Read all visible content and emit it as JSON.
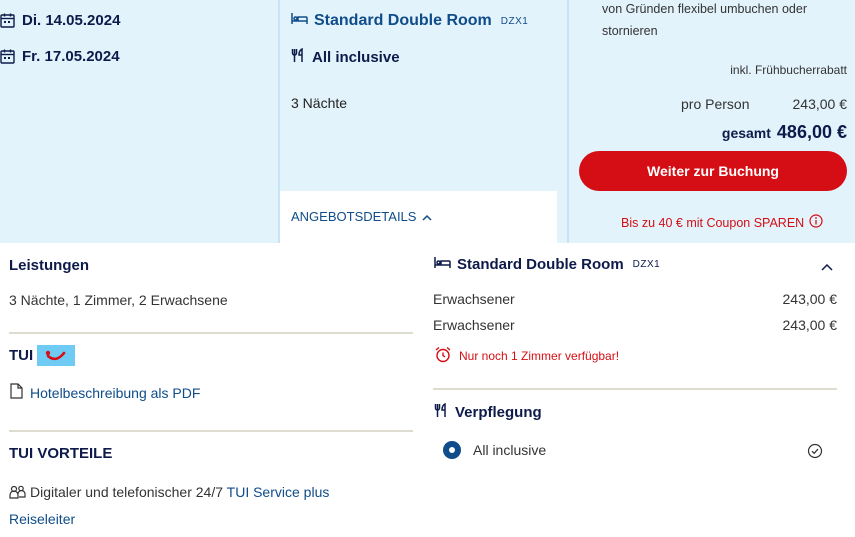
{
  "dates": {
    "arrival": "Di. 14.05.2024",
    "departure": "Fr. 17.05.2024"
  },
  "offer": {
    "room_name": "Standard Double Room",
    "room_code": "DZX1",
    "board": "All inclusive",
    "nights": "3 Nächte",
    "details_tab": "ANGEBOTSDETAILS"
  },
  "pricing": {
    "flex_text": "von Gründen flexibel umbuchen oder stornieren",
    "early_booking": "inkl. Frühbucherrabatt",
    "per_person_label": "pro Person",
    "per_person_value": "243,00 €",
    "total_label": "gesamt",
    "total_value": "486,00 €",
    "book_button": "Weiter zur Buchung",
    "coupon_text": "Bis zu 40 € mit Coupon SPAREN"
  },
  "services": {
    "heading": "Leistungen",
    "summary": "3 Nächte, 1 Zimmer, 2 Erwachsene",
    "brand": "TUI",
    "pdf_link": "Hotelbeschreibung als PDF",
    "benefits_heading": "TUI VORTEILE",
    "benefit_text": "Digitaler und telefonischer 24/7",
    "benefit_link": "TUI Service plus Reiseleiter"
  },
  "room_details": {
    "title": "Standard Double Room",
    "code": "DZX1",
    "lines": [
      {
        "label": "Erwachsener",
        "price": "243,00 €"
      },
      {
        "label": "Erwachsener",
        "price": "243,00 €"
      }
    ],
    "availability": "Nur noch 1 Zimmer verfügbar!",
    "board_heading": "Verpflegung",
    "board_option": "All inclusive"
  },
  "colors": {
    "accent_red": "#d40e14",
    "brand_blue": "#0f4c8a",
    "panel_bg": "#e3f3fc",
    "tui_badge": "#70cbf4"
  }
}
